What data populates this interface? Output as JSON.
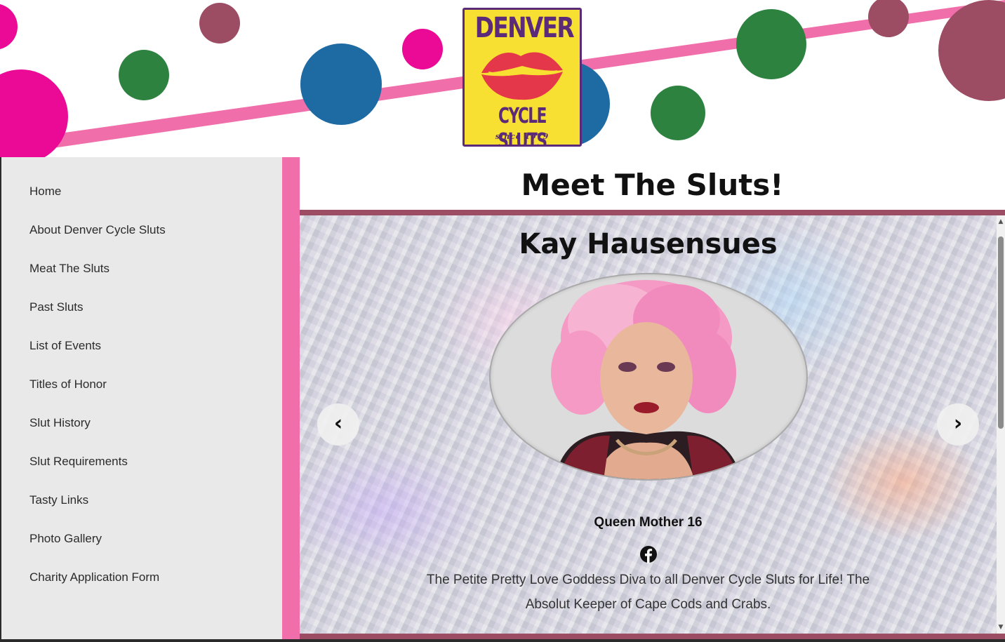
{
  "brand": {
    "logo_top": "DENVER",
    "logo_bottom": "CYCLE SLUTS",
    "logo_since": "since 1979"
  },
  "sidebar": {
    "items": [
      {
        "label": "Home"
      },
      {
        "label": "About Denver Cycle Sluts"
      },
      {
        "label": "Meat The Sluts"
      },
      {
        "label": "Past Sluts"
      },
      {
        "label": "List of Events"
      },
      {
        "label": "Titles of Honor"
      },
      {
        "label": "Slut History"
      },
      {
        "label": "Slut Requirements"
      },
      {
        "label": "Tasty Links"
      },
      {
        "label": "Photo Gallery"
      },
      {
        "label": "Charity Application Form"
      }
    ]
  },
  "main": {
    "page_title": "Meet The Sluts!",
    "slide": {
      "name": "Kay Hausensues",
      "title": "Queen Mother 16",
      "social_icon": "facebook-icon",
      "description": "The Petite Pretty Love Goddess Diva to all Denver Cycle Sluts for Life! The Absolut Keeper of Cape Cods and Crabs.",
      "prev_label": "‹",
      "next_label": "›"
    }
  },
  "colors": {
    "sidebar_stripe": "#f06faa",
    "rule": "#9c4c63",
    "logo_bg": "#f7e031",
    "logo_text": "#5b2a79",
    "lips": "#e4384a",
    "dots": [
      "#ea0a96",
      "#9c4c63",
      "#2d8240",
      "#1e6aa3"
    ]
  }
}
